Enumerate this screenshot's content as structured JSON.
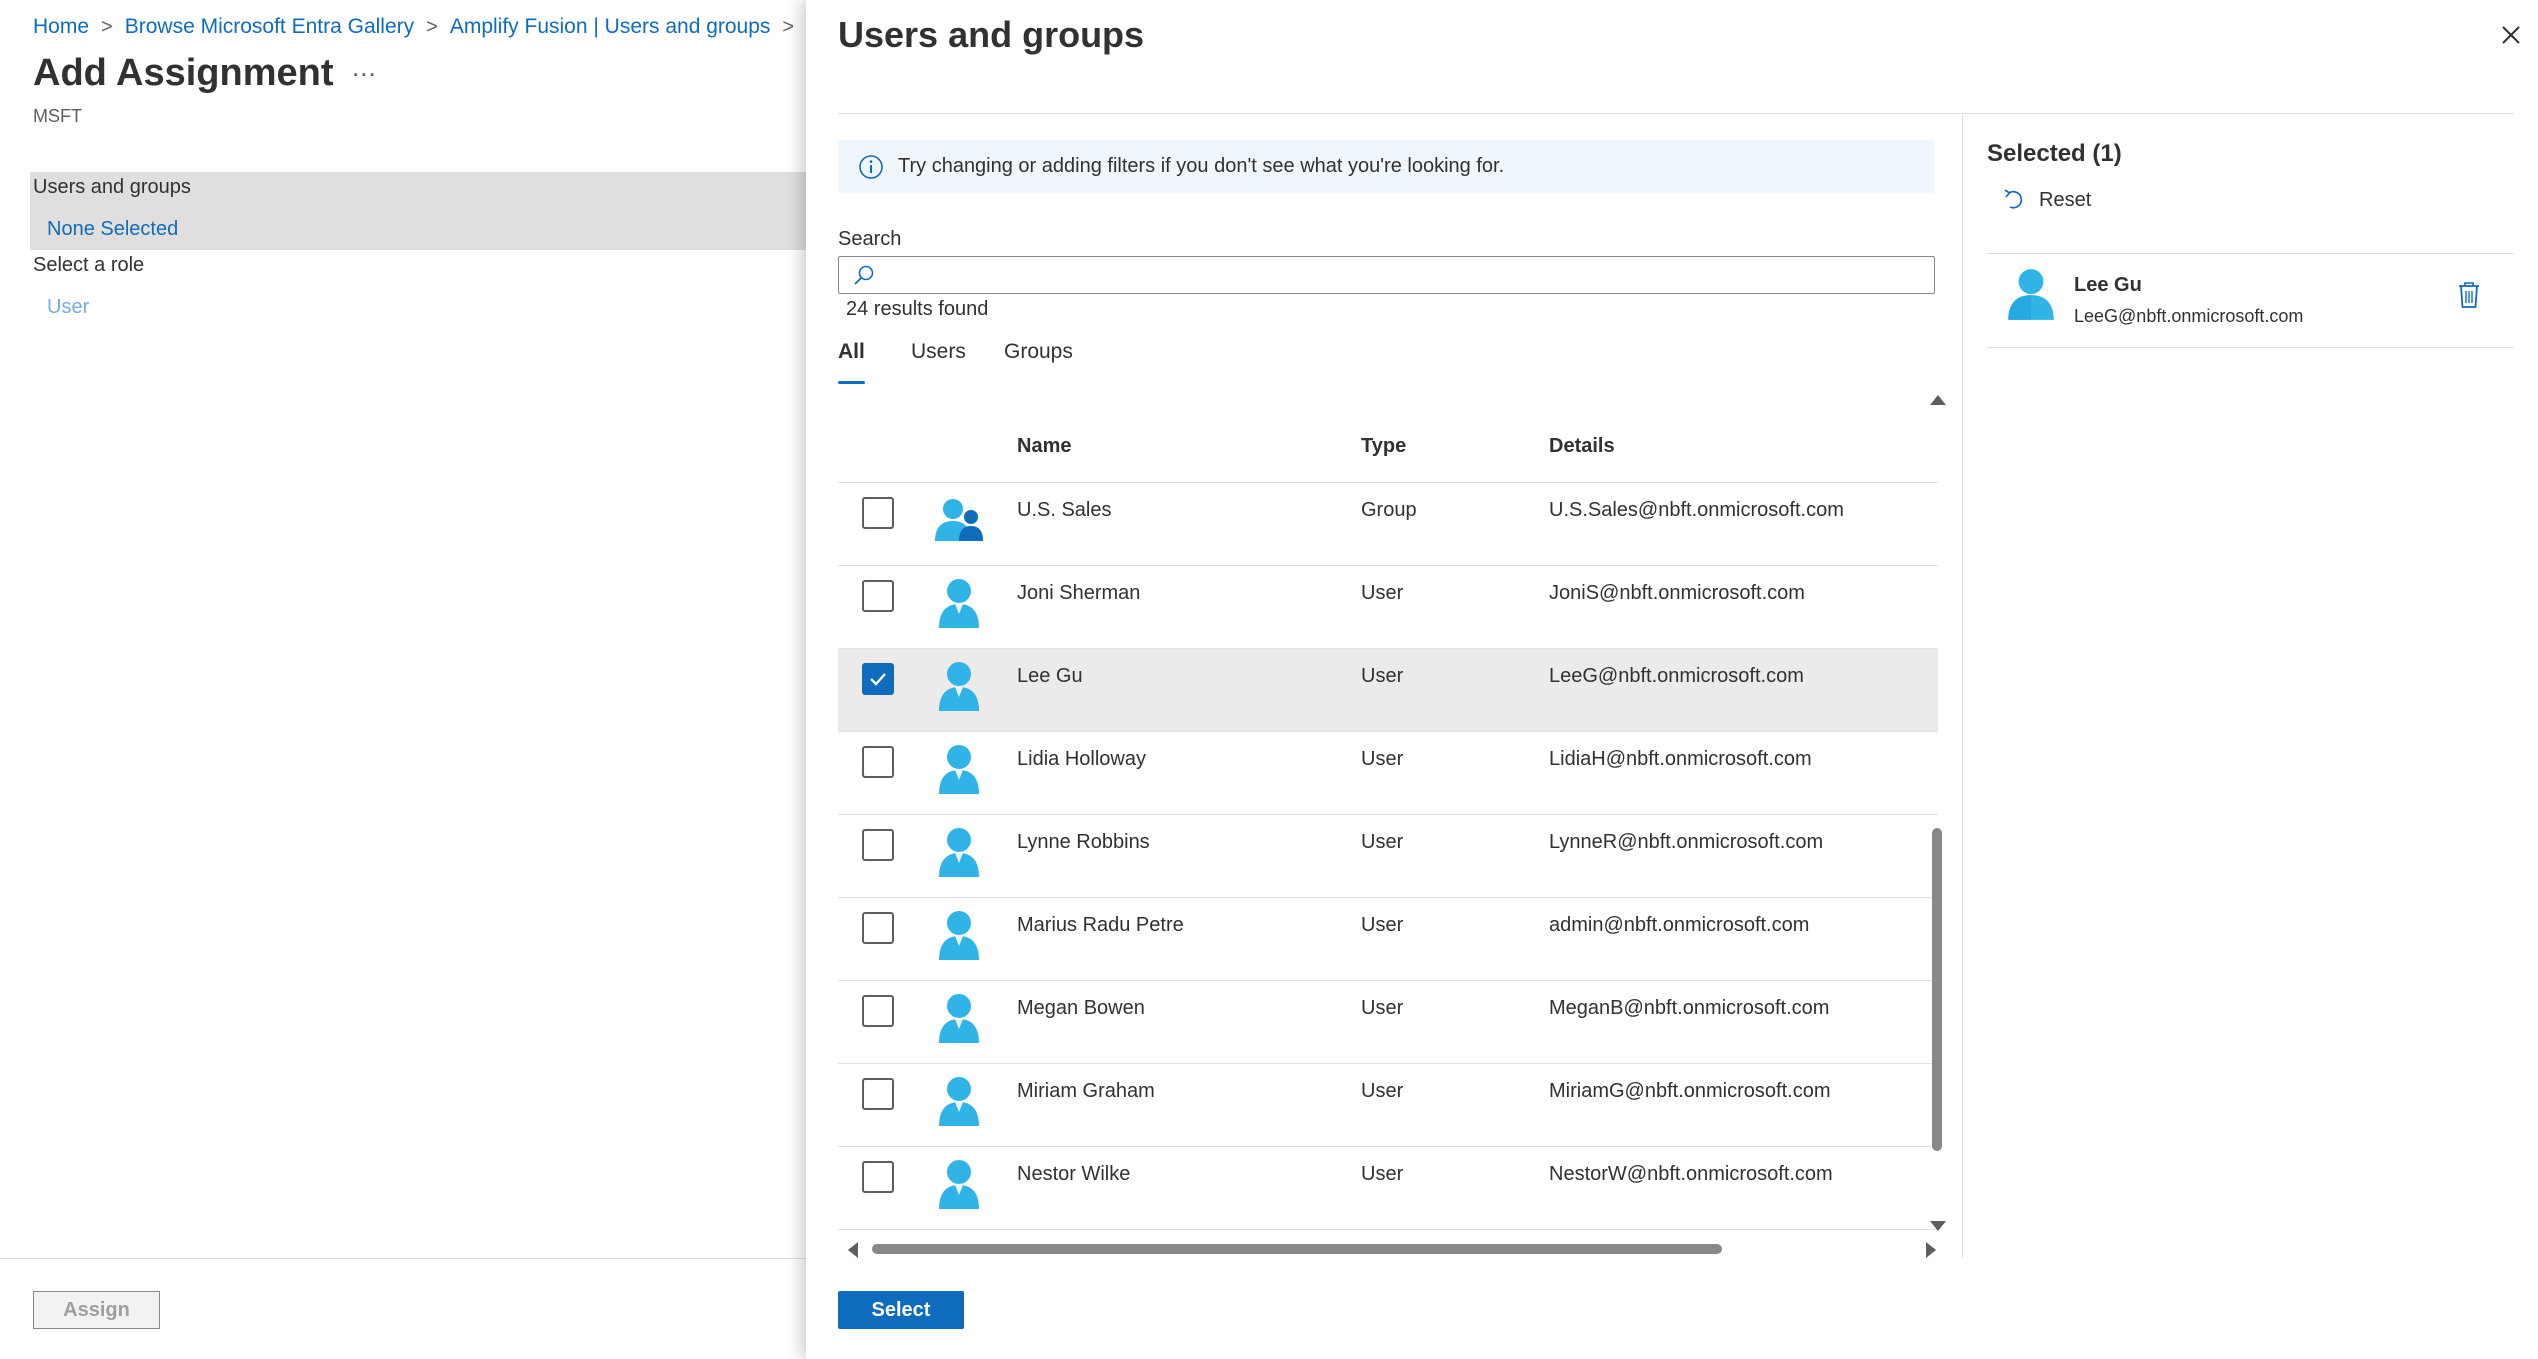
{
  "breadcrumb": {
    "items": [
      "Home",
      "Browse Microsoft Entra Gallery",
      "Amplify Fusion | Users and groups"
    ],
    "separator": ">"
  },
  "page": {
    "title": "Add Assignment",
    "more_label": "...",
    "subtitle": "MSFT"
  },
  "left_sections": {
    "users_groups_label": "Users and groups",
    "users_groups_value": "None Selected",
    "role_label": "Select a role",
    "role_value": "User"
  },
  "footer": {
    "assign_label": "Assign"
  },
  "panel": {
    "title": "Users and groups",
    "info_text": "Try changing or adding filters if you don't see what you're looking for.",
    "search_label": "Search",
    "search_value": "",
    "results_count": "24 results found",
    "tabs": [
      "All",
      "Users",
      "Groups"
    ],
    "active_tab": "All",
    "columns": [
      "Name",
      "Type",
      "Details"
    ],
    "rows": [
      {
        "name": "U.S. Sales",
        "type": "Group",
        "details": "U.S.Sales@nbft.onmicrosoft.com",
        "checked": false,
        "icon": "group-icon"
      },
      {
        "name": "Joni Sherman",
        "type": "User",
        "details": "JoniS@nbft.onmicrosoft.com",
        "checked": false,
        "icon": "user-icon"
      },
      {
        "name": "Lee Gu",
        "type": "User",
        "details": "LeeG@nbft.onmicrosoft.com",
        "checked": true,
        "icon": "user-icon"
      },
      {
        "name": "Lidia Holloway",
        "type": "User",
        "details": "LidiaH@nbft.onmicrosoft.com",
        "checked": false,
        "icon": "user-icon"
      },
      {
        "name": "Lynne Robbins",
        "type": "User",
        "details": "LynneR@nbft.onmicrosoft.com",
        "checked": false,
        "icon": "user-icon"
      },
      {
        "name": "Marius Radu Petre",
        "type": "User",
        "details": "admin@nbft.onmicrosoft.com",
        "checked": false,
        "icon": "user-icon"
      },
      {
        "name": "Megan Bowen",
        "type": "User",
        "details": "MeganB@nbft.onmicrosoft.com",
        "checked": false,
        "icon": "user-icon"
      },
      {
        "name": "Miriam Graham",
        "type": "User",
        "details": "MiriamG@nbft.onmicrosoft.com",
        "checked": false,
        "icon": "user-icon"
      },
      {
        "name": "Nestor Wilke",
        "type": "User",
        "details": "NestorW@nbft.onmicrosoft.com",
        "checked": false,
        "icon": "user-icon"
      }
    ],
    "select_label": "Select"
  },
  "selected": {
    "title": "Selected (1)",
    "reset_label": "Reset",
    "items": [
      {
        "name": "Lee Gu",
        "email": "LeeG@nbft.onmicrosoft.com"
      }
    ]
  },
  "colors": {
    "accent": "#0f6cbd",
    "avatar": "#30b4e8",
    "info_bg": "#eff6fc",
    "row_selected": "#edebe9"
  }
}
